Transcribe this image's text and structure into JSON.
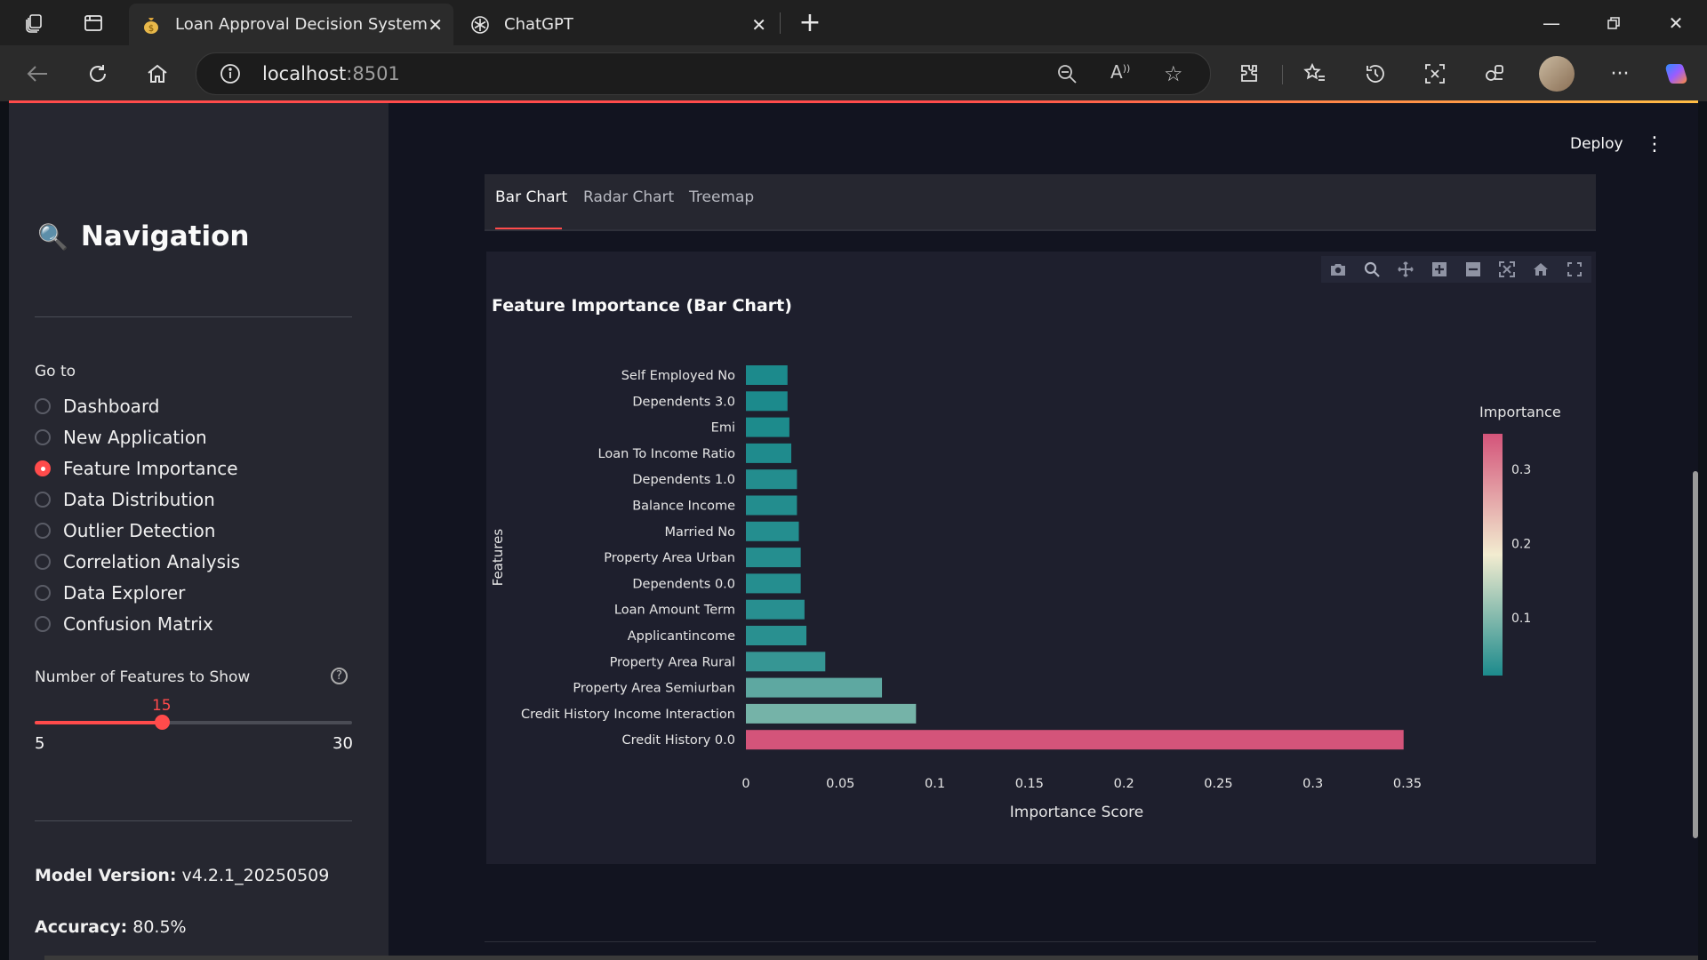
{
  "browser": {
    "tabs": [
      {
        "title": "Loan Approval Decision System",
        "favicon": "money-bag-icon",
        "active": true
      },
      {
        "title": "ChatGPT",
        "favicon": "openai-icon",
        "active": false
      }
    ],
    "url_host": "localhost",
    "url_port": ":8501"
  },
  "sidebar": {
    "nav_icon": "🔍",
    "nav_title": "Navigation",
    "goto_label": "Go to",
    "items": [
      {
        "label": "Dashboard",
        "selected": false
      },
      {
        "label": "New Application",
        "selected": false
      },
      {
        "label": "Feature Importance",
        "selected": true
      },
      {
        "label": "Data Distribution",
        "selected": false
      },
      {
        "label": "Outlier Detection",
        "selected": false
      },
      {
        "label": "Correlation Analysis",
        "selected": false
      },
      {
        "label": "Data Explorer",
        "selected": false
      },
      {
        "label": "Confusion Matrix",
        "selected": false
      }
    ],
    "slider": {
      "label": "Number of Features to Show",
      "value": "15",
      "min": "5",
      "max": "30"
    },
    "model_version_label": "Model Version:",
    "model_version_value": " v4.2.1_20250509",
    "accuracy_label": "Accuracy:",
    "accuracy_value": " 80.5%"
  },
  "header": {
    "deploy_label": "Deploy"
  },
  "main": {
    "tabs": [
      {
        "label": "Bar Chart",
        "active": true
      },
      {
        "label": "Radar Chart",
        "active": false
      },
      {
        "label": "Treemap",
        "active": false
      }
    ]
  },
  "colors": {
    "accent": "#ff4b4b",
    "sidebar_bg": "#262730",
    "colorscale_low": "#1c8a8c",
    "colorscale_mid": "#f2ecd0",
    "colorscale_high": "#d4547a"
  },
  "chart_data": {
    "type": "bar",
    "orientation": "horizontal",
    "title": "Feature Importance (Bar Chart)",
    "xlabel": "Importance Score",
    "ylabel": "Features",
    "xlim": [
      0,
      0.35
    ],
    "xticks": [
      "0",
      "0.05",
      "0.1",
      "0.15",
      "0.2",
      "0.25",
      "0.3",
      "0.35"
    ],
    "categories": [
      "Self Employed No",
      "Dependents 3.0",
      "Emi",
      "Loan To Income Ratio",
      "Dependents 1.0",
      "Balance Income",
      "Married No",
      "Property Area Urban",
      "Dependents 0.0",
      "Loan Amount Term",
      "Applicantincome",
      "Property Area Rural",
      "Property Area Semiurban",
      "Credit History Income Interaction",
      "Credit History 0.0"
    ],
    "values": [
      0.022,
      0.022,
      0.023,
      0.024,
      0.027,
      0.027,
      0.028,
      0.029,
      0.029,
      0.031,
      0.032,
      0.042,
      0.072,
      0.09,
      0.348
    ],
    "colorbar": {
      "title": "Importance",
      "ticks": [
        "0.1",
        "0.2",
        "0.3"
      ],
      "range": [
        0.022,
        0.348
      ]
    },
    "legend": "none",
    "grid": false
  }
}
